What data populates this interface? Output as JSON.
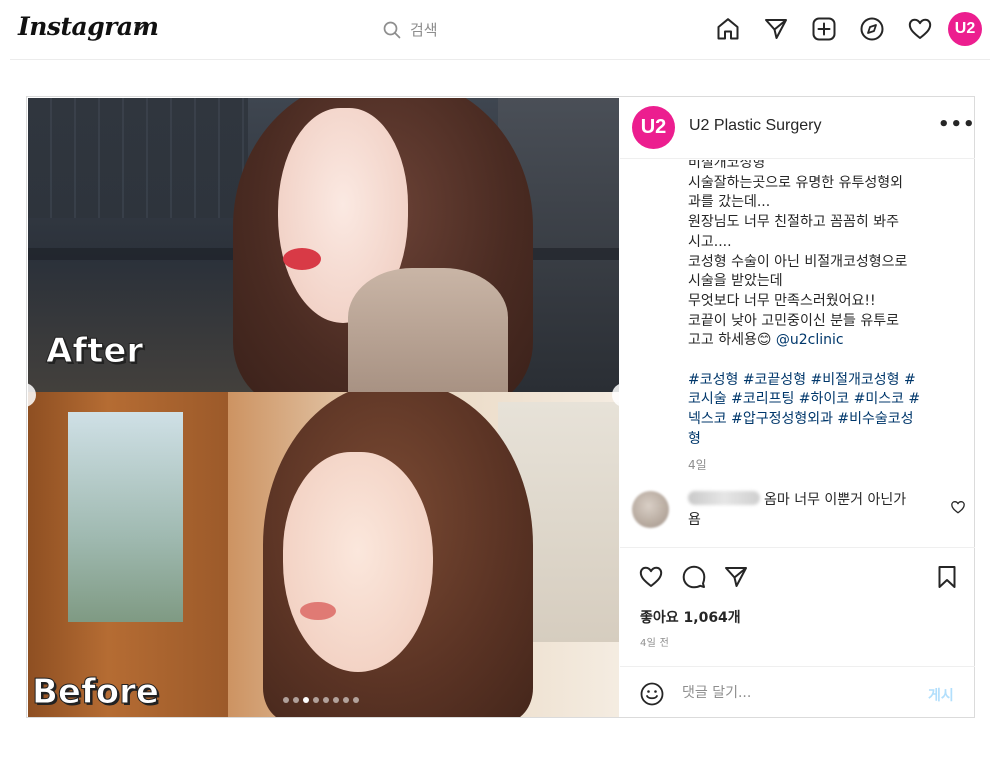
{
  "nav": {
    "logo": "Instagram",
    "search_placeholder": "검색",
    "avatar_text": "U2",
    "icons": [
      "home-icon",
      "direct-icon",
      "new-post-icon",
      "explore-icon",
      "activity-heart-icon"
    ]
  },
  "post": {
    "media": {
      "label_top": "After",
      "label_bottom": "Before",
      "carousel_dots": 8,
      "active_dot_index": 2
    },
    "author": {
      "avatar_text": "U2",
      "username": "U2 Plastic Surgery"
    },
    "caption": {
      "lines": [
        "비절개코성형",
        "시술잘하는곳으로 유명한 유투성형외",
        "과를 갔는데...",
        "원장님도 너무 친절하고 꼼꼼히 봐주",
        "시고....",
        "코성형 수술이 아닌 비절개코성형으로",
        "시술을 받았는데",
        "무엇보다 너무 만족스러웠어요!!",
        "코끝이 낮아 고민중이신 분들 유투로",
        "고고 하세용😊 "
      ],
      "mention": "@u2clinic",
      "hashtag_lines": [
        "#코성형 #코끝성형 #비절개코성형 #",
        "코시술 #코리프팅 #하이코 #미스코 #",
        "넥스코 #압구정성형외과 #비수술코성",
        "형"
      ],
      "age": "4일"
    },
    "comment": {
      "text": "옴마 너무 이뿐거 아닌가",
      "text_wrap": "욤"
    },
    "likes": "좋아요 1,064개",
    "posted": "4일 전",
    "add_comment": {
      "placeholder": "댓글 달기...",
      "post_label": "게시"
    }
  },
  "colors": {
    "brand_pink": "#ec1e8f",
    "link_blue": "#00376b",
    "muted_gray": "#8e8e8e",
    "post_disabled": "#b2dffc"
  }
}
